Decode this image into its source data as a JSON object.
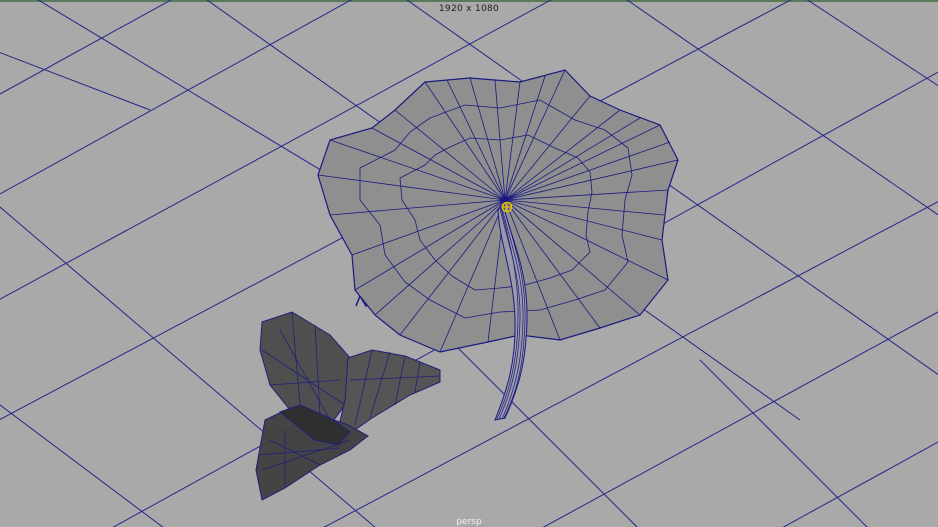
{
  "viewport": {
    "resolution_gate_label": "1920 x 1080",
    "camera_label": "persp",
    "background_color": "#a9a9a9",
    "grid_color": "#26268a",
    "wire_color": "#1a1a80",
    "leaf_fill": "#8e8e8e",
    "small_leaves_fill": "#4a4a4a",
    "pivot_color": "#e8c000"
  },
  "scene_objects": [
    {
      "name": "lily-pad-leaf",
      "kind": "polygon mesh"
    },
    {
      "name": "leaf-stem",
      "kind": "polygon mesh"
    },
    {
      "name": "small-leaves-cluster",
      "kind": "polygon mesh"
    },
    {
      "name": "pivot-manipulator",
      "kind": "manipulator"
    }
  ]
}
